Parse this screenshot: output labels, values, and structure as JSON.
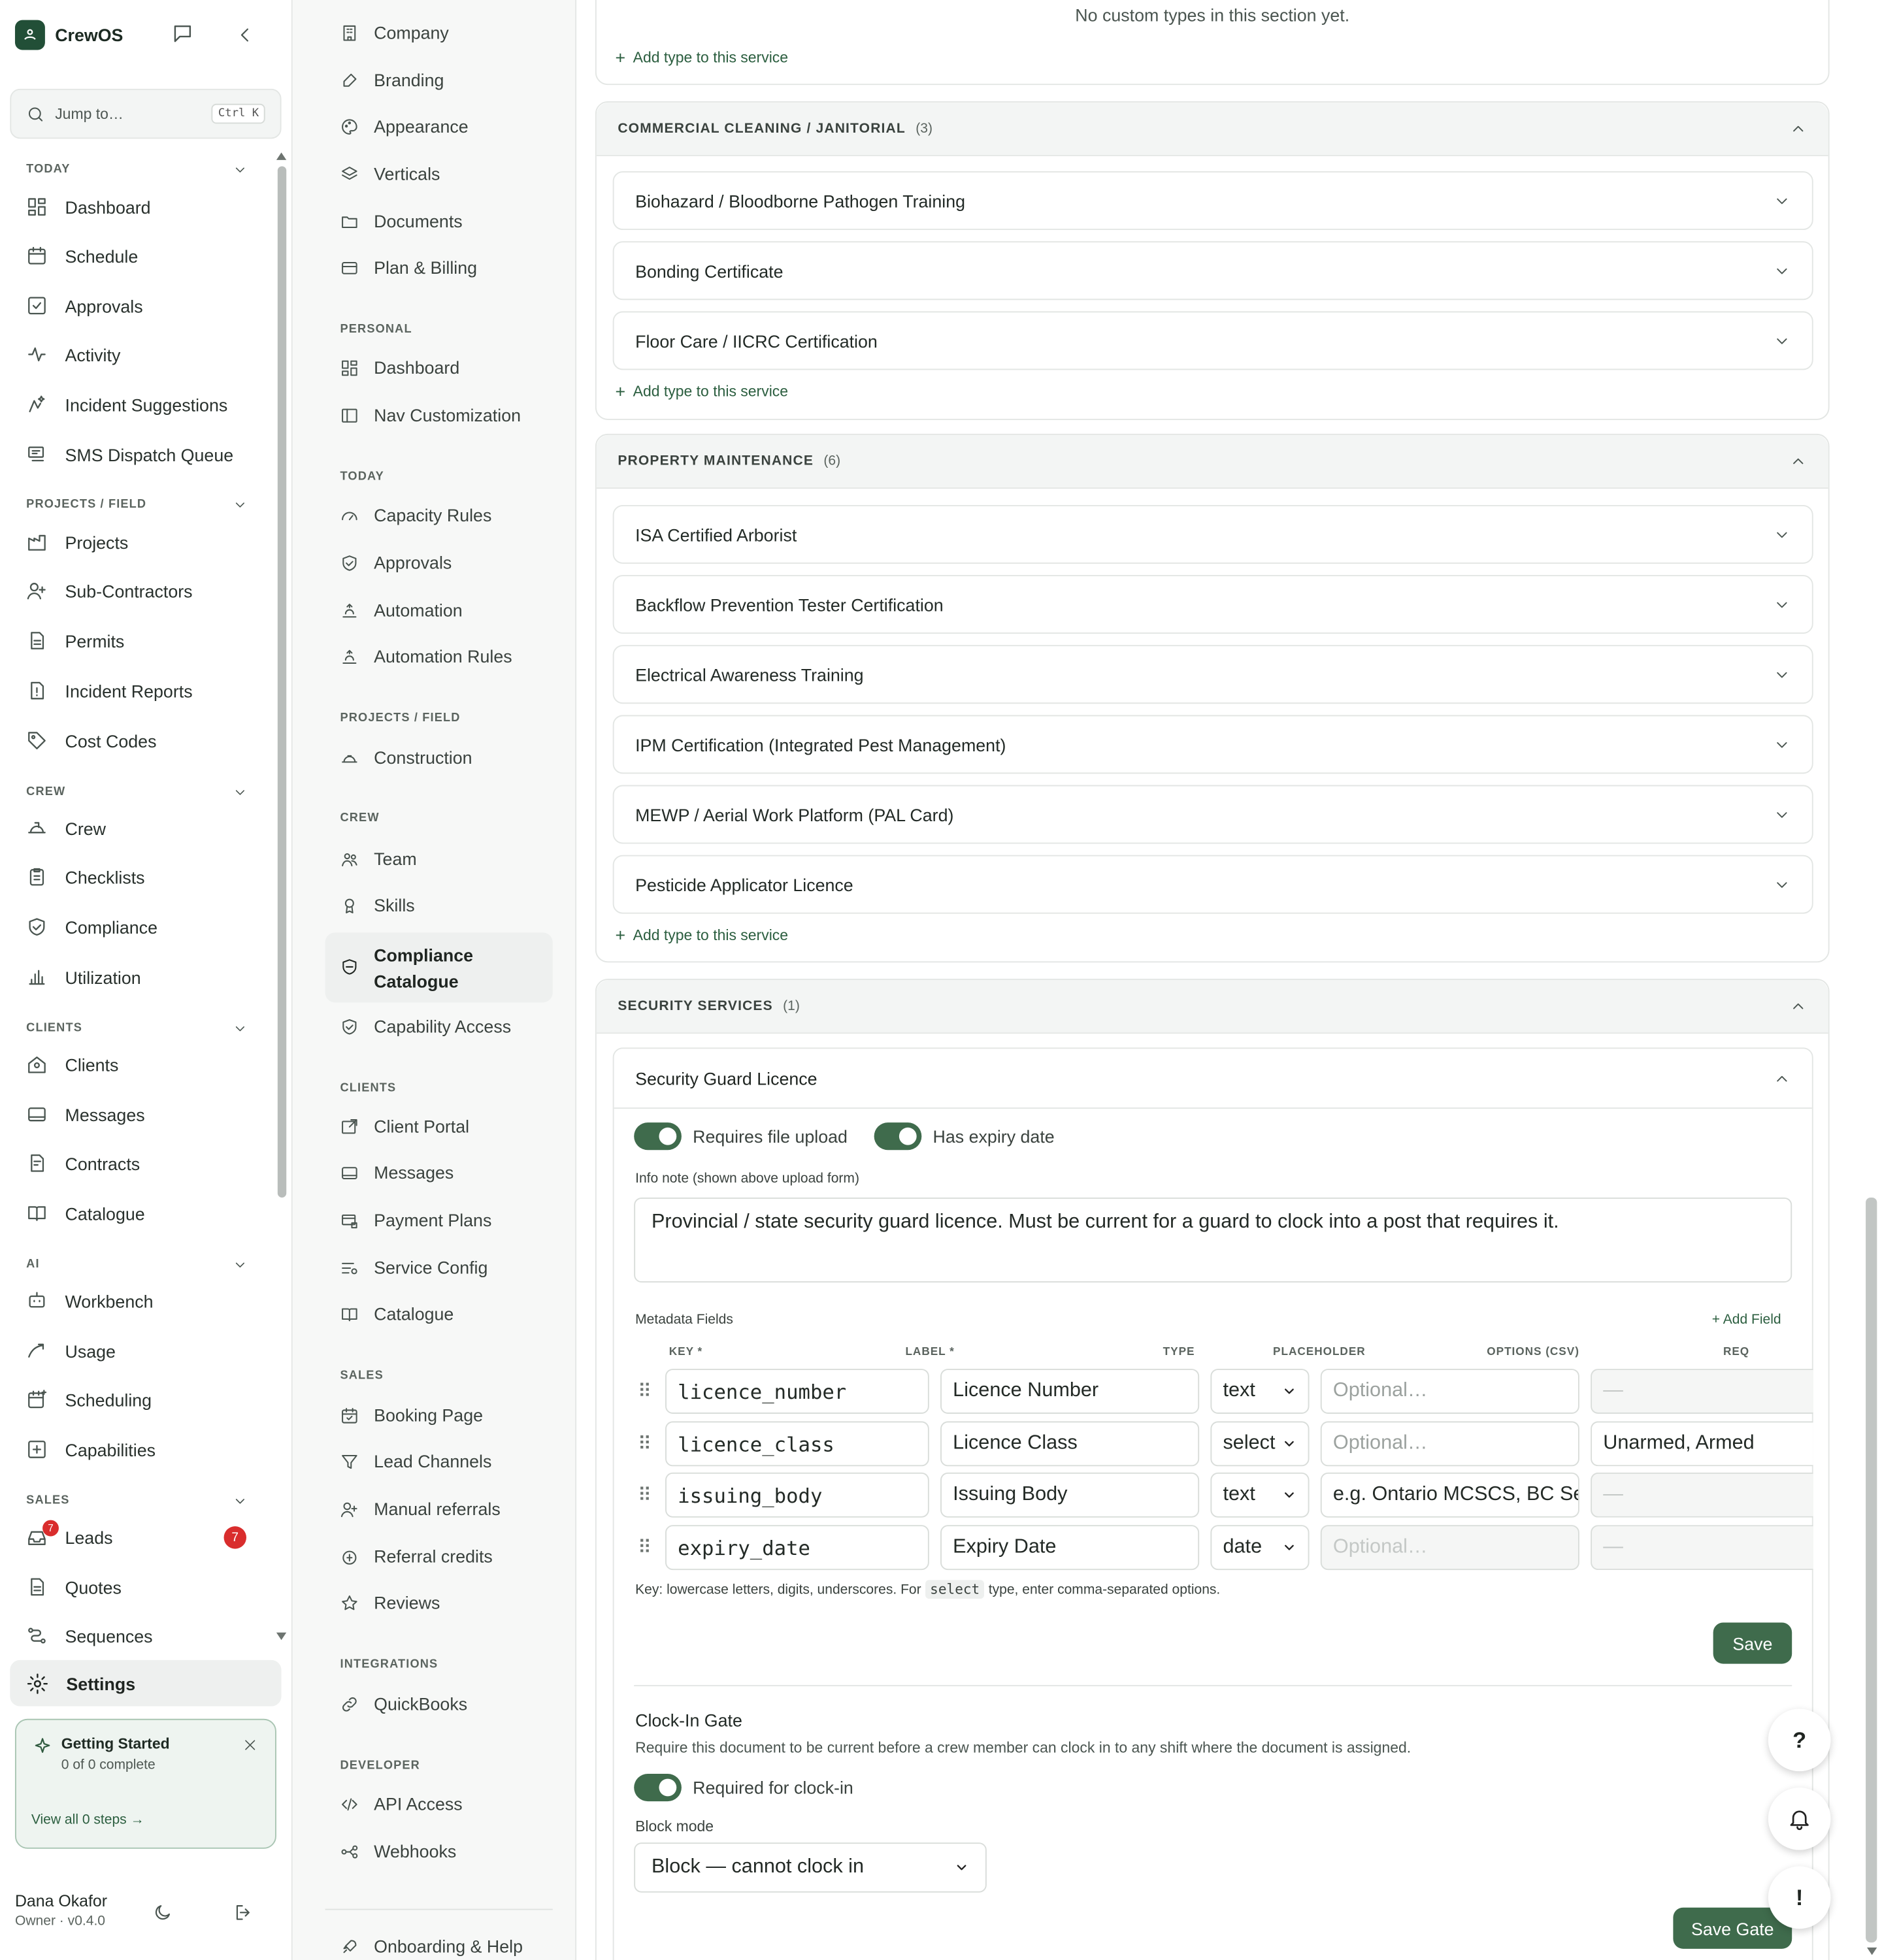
{
  "app": {
    "name": "CrewOS"
  },
  "search": {
    "placeholder": "Jump to…",
    "shortcut": "Ctrl K"
  },
  "nav": {
    "today_label": "TODAY",
    "today": [
      "Dashboard",
      "Schedule",
      "Approvals",
      "Activity",
      "Incident Suggestions",
      "SMS Dispatch Queue"
    ],
    "projects_label": "PROJECTS / FIELD",
    "projects": [
      "Projects",
      "Sub-Contractors",
      "Permits",
      "Incident Reports",
      "Cost Codes"
    ],
    "crew_label": "CREW",
    "crew": [
      "Crew",
      "Checklists",
      "Compliance",
      "Utilization"
    ],
    "clients_label": "CLIENTS",
    "clients": [
      "Clients",
      "Messages",
      "Contracts",
      "Catalogue"
    ],
    "ai_label": "AI",
    "ai": [
      "Workbench",
      "Usage",
      "Scheduling",
      "Capabilities"
    ],
    "sales_label": "SALES",
    "sales": [
      "Leads",
      "Quotes",
      "Sequences"
    ],
    "leads_badge": "7",
    "settings": "Settings"
  },
  "getting_started": {
    "title": "Getting Started",
    "progress": "0 of 0 complete",
    "link": "View all 0 steps →"
  },
  "user": {
    "name": "Dana Okafor",
    "role": "Owner · v0.4.0"
  },
  "settings_nav": {
    "org": [
      "Company",
      "Branding",
      "Appearance",
      "Verticals",
      "Documents",
      "Plan & Billing"
    ],
    "personal_label": "PERSONAL",
    "personal": [
      "Dashboard",
      "Nav Customization"
    ],
    "today_label": "TODAY",
    "today": [
      "Capacity Rules",
      "Approvals",
      "Automation",
      "Automation Rules"
    ],
    "projects_label": "PROJECTS / FIELD",
    "projects": [
      "Construction"
    ],
    "crew_label": "CREW",
    "crew": [
      "Team",
      "Skills",
      "Compliance Catalogue",
      "Capability Access"
    ],
    "clients_label": "CLIENTS",
    "clients": [
      "Client Portal",
      "Messages",
      "Payment Plans",
      "Service Config",
      "Catalogue"
    ],
    "sales_label": "SALES",
    "sales": [
      "Booking Page",
      "Lead Channels",
      "Manual referrals",
      "Referral credits",
      "Reviews"
    ],
    "integrations_label": "INTEGRATIONS",
    "integrations": [
      "QuickBooks"
    ],
    "developer_label": "DEVELOPER",
    "developer": [
      "API Access",
      "Webhooks"
    ],
    "help": "Onboarding & Help"
  },
  "main": {
    "empty_text": "No custom types in this section yet.",
    "add_type": "Add type to this service",
    "sections": [
      {
        "title": "COMMERCIAL CLEANING / JANITORIAL",
        "count": "(3)",
        "items": [
          "Biohazard / Bloodborne Pathogen Training",
          "Bonding Certificate",
          "Floor Care / IICRC Certification"
        ]
      },
      {
        "title": "PROPERTY MAINTENANCE",
        "count": "(6)",
        "items": [
          "ISA Certified Arborist",
          "Backflow Prevention Tester Certification",
          "Electrical Awareness Training",
          "IPM Certification (Integrated Pest Management)",
          "MEWP / Aerial Work Platform (PAL Card)",
          "Pesticide Applicator Licence"
        ]
      },
      {
        "title": "SECURITY SERVICES",
        "count": "(1)"
      }
    ],
    "expanded": {
      "title": "Security Guard Licence",
      "requires_upload": "Requires file upload",
      "has_expiry": "Has expiry date",
      "info_label": "Info note (shown above upload form)",
      "info_value": "Provincial / state security guard licence. Must be current for a guard to clock into a post that requires it.",
      "metadata_label": "Metadata Fields",
      "add_field": "Add Field",
      "columns": {
        "key": "KEY *",
        "label": "LABEL *",
        "type": "TYPE",
        "placeholder": "PLACEHOLDER",
        "options": "OPTIONS (CSV)",
        "req": "REQ"
      },
      "rows": [
        {
          "key": "licence_number",
          "label": "Licence Number",
          "type": "text",
          "placeholder": "Optional…",
          "options": "—"
        },
        {
          "key": "licence_class",
          "label": "Licence Class",
          "type": "select",
          "placeholder": "Optional…",
          "options": "Unarmed, Armed"
        },
        {
          "key": "issuing_body",
          "label": "Issuing Body",
          "type": "text",
          "placeholder": "e.g. Ontario MCSCS, BC Sec",
          "options": "—"
        },
        {
          "key": "expiry_date",
          "label": "Expiry Date",
          "type": "date",
          "placeholder": "Optional…",
          "options": "—"
        }
      ],
      "hint_before": "Key: lowercase letters, digits, underscores. For",
      "hint_code": "select",
      "hint_after": "type, enter comma-separated options.",
      "save": "Save",
      "gate_title": "Clock-In Gate",
      "gate_desc": "Require this document to be current before a crew member can clock in to any shift where the document is assigned.",
      "gate_toggle": "Required for clock-in",
      "block_label": "Block mode",
      "block_value": "Block — cannot clock in",
      "save_gate": "Save Gate"
    }
  },
  "fabs": {
    "help": "?",
    "alert": "!"
  }
}
